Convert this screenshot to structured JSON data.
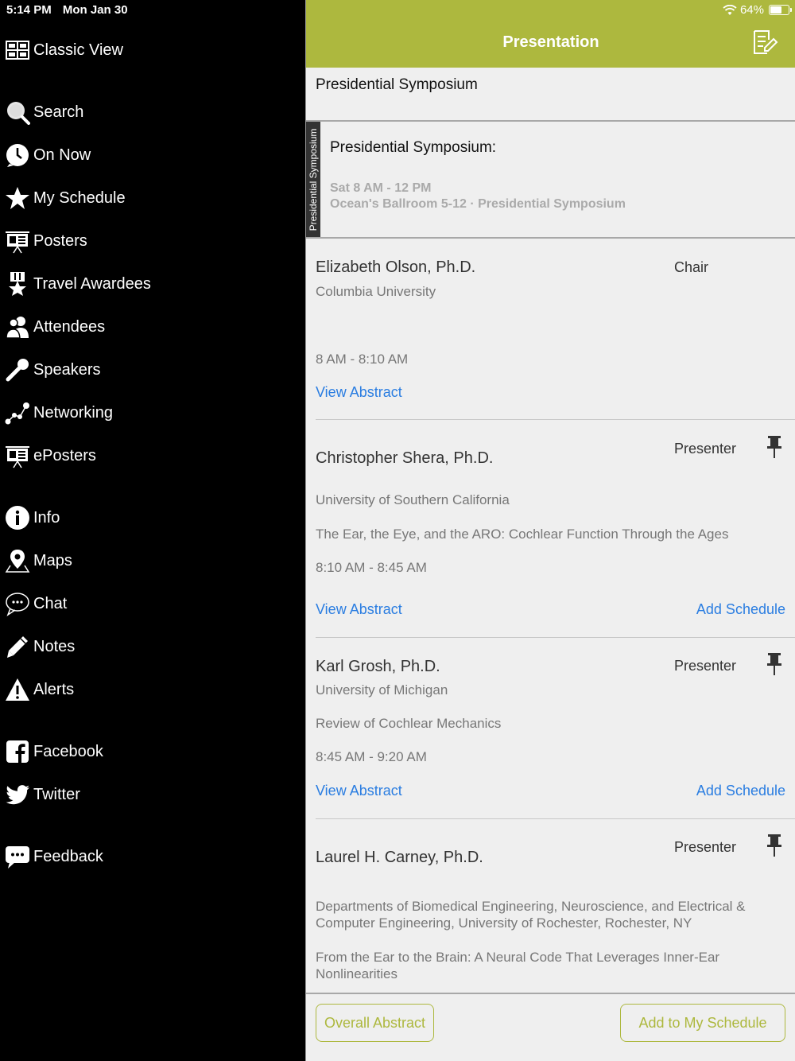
{
  "status": {
    "time": "5:14 PM",
    "date": "Mon Jan 30",
    "battery": "64%",
    "battery_level": 0.64
  },
  "sidebar": {
    "items": [
      {
        "label": "Classic View",
        "icon": "grid-icon"
      },
      {
        "label": "Search",
        "icon": "search-icon"
      },
      {
        "label": "On Now",
        "icon": "clock-icon"
      },
      {
        "label": "My Schedule",
        "icon": "star-icon"
      },
      {
        "label": "Posters",
        "icon": "poster-icon"
      },
      {
        "label": "Travel Awardees",
        "icon": "award-icon"
      },
      {
        "label": "Attendees",
        "icon": "people-icon"
      },
      {
        "label": "Speakers",
        "icon": "microphone-icon"
      },
      {
        "label": "Networking",
        "icon": "network-icon"
      },
      {
        "label": "ePosters",
        "icon": "eposter-icon"
      },
      {
        "label": "Info",
        "icon": "info-icon"
      },
      {
        "label": "Maps",
        "icon": "map-pin-icon"
      },
      {
        "label": "Chat",
        "icon": "chat-icon"
      },
      {
        "label": "Notes",
        "icon": "pencil-icon"
      },
      {
        "label": "Alerts",
        "icon": "warning-icon"
      },
      {
        "label": "Facebook",
        "icon": "facebook-icon"
      },
      {
        "label": "Twitter",
        "icon": "twitter-icon"
      },
      {
        "label": "Feedback",
        "icon": "feedback-icon"
      }
    ]
  },
  "header": {
    "title": "Presentation",
    "action_icon": "edit-note-icon"
  },
  "session": {
    "title": "Presidential Symposium",
    "track": "Presidential Symposium",
    "name": "Presidential Symposium:",
    "time": "Sat 8 AM - 12 PM",
    "location": "Ocean's Ballroom 5-12 · Presidential Symposium"
  },
  "presenters": [
    {
      "name": "Elizabeth Olson, Ph.D.",
      "role": "Chair",
      "affiliation": "Columbia University",
      "time": "8 AM - 8:10 AM",
      "view_abstract": "View Abstract"
    },
    {
      "name": "Christopher Shera, Ph.D.",
      "role": "Presenter",
      "affiliation": "University of Southern California",
      "talk": "The Ear, the Eye, and the ARO: Cochlear Function Through the Ages",
      "time": "8:10 AM - 8:45 AM",
      "view_abstract": "View Abstract",
      "add_schedule": "Add Schedule"
    },
    {
      "name": "Karl Grosh, Ph.D.",
      "role": "Presenter",
      "affiliation": "University of Michigan",
      "talk": "Review of Cochlear Mechanics",
      "time": "8:45 AM - 9:20 AM",
      "view_abstract": "View Abstract",
      "add_schedule": "Add Schedule"
    },
    {
      "name": "Laurel H. Carney, Ph.D.",
      "role": "Presenter",
      "affiliation": "Departments of Biomedical Engineering, Neuroscience, and Electrical & Computer Engineering, University of Rochester, Rochester, NY",
      "talk": "From the Ear to the Brain: A Neural Code That Leverages Inner-Ear Nonlinearities"
    }
  ],
  "footer": {
    "overall_abstract": "Overall Abstract",
    "add_to_schedule": "Add to My Schedule"
  },
  "colors": {
    "accent": "#adb83e",
    "link": "#2a7de1"
  }
}
